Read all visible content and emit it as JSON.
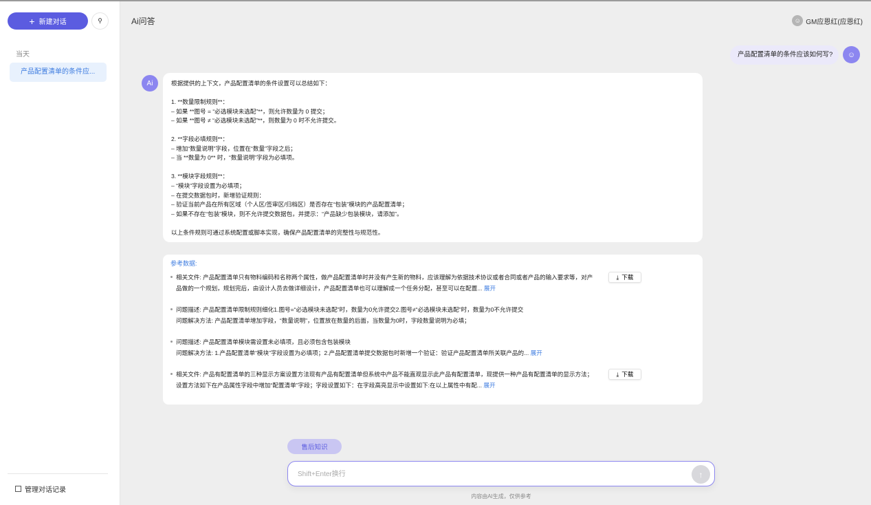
{
  "sidebar": {
    "new_chat": "新建对话",
    "search_icon": "search-icon",
    "section": "当天",
    "conversations": [
      "产品配置清单的条件应..."
    ],
    "manage": "管理对话记录"
  },
  "header": {
    "title": "Ai问答",
    "user": "GM应恩红(应恩红)"
  },
  "chat": {
    "user_message": "产品配置清单的条件应该如何写?",
    "ai_avatar": "Ai",
    "answer": "根据提供的上下文，产品配置清单的条件设置可以总结如下：\n\n1. **数量限制规则**：\n– 如果 **图号 = “必选模块未选配”**，则允许数量为 0 提交；\n– 如果 **图号 ≠ “必选模块未选配”**，则数量为 0 时不允许提交。\n\n2. **字段必填规则**：\n– 增加“数量说明”字段，位置在“数量”字段之后；\n– 当 **数量为 0** 时，“数量说明”字段为必填项。\n\n3. **模块字段规则**：\n– “模块”字段设置为必填项；\n– 在提交数据包时，新增验证规则：\n– 验证当前产品在所有区域（个人区/签审区/归档区）是否存在“包装”模块的产品配置清单；\n– 如果不存在“包装”模块，则不允许提交数据包，并提示：“产品缺少包装模块，请添加”。\n\n以上条件规则可通过系统配置或脚本实现，确保产品配置清单的完整性与规范性。",
    "references_title": "参考数据:",
    "references": [
      {
        "text": "相关文件: 产品配置清单只有物料编码和名称两个属性，做产品配置清单时并没有产生新的物料，应该理解为依据技术协议或者合同或者产品的输入要求等，对产品做的一个规划，规划完后，由设计人员去做详细设计，产品配置清单也可以理解成一个任务分配，甚至可以在配置...",
        "more": "展开",
        "download": "下载"
      },
      {
        "text": "问题描述: 产品配置清单限制规则细化1.图号=“必选模块未选配”时，数量为0允许提交2.图号≠“必选模块未选配”时，数量为0不允许提交\n问题解决方法: 产品配置清单增加字段，“数量说明”，位置放在数量的后面，当数量为0时，字段数量说明为必填；"
      },
      {
        "text": "问题描述: 产品配置清单模块需设置未必填项，且必须包含包装模块\n问题解决方法: 1.产品配置清单“模块”字段设置为必填项；2.产品配置清单提交数据包时新增一个验证：验证产品配置清单所关联产品的...",
        "more": "展开"
      },
      {
        "text": "相关文件: 产品有配置清单的三种显示方案设置方法现有产品有配置清单但系统中产品不能直观显示此产品有配置清单，现提供一种产品有配置清单的显示方法；设置方法如下在产品属性字段中增加“配置清单”字段；字段设置如下：在字段高亮显示中设置如下:在以上属性中有配...",
        "more": "展开",
        "download": "下载"
      }
    ]
  },
  "composer": {
    "tag": "售后知识",
    "placeholder": "Shift+Enter换行",
    "disclaimer": "内容由AI生成，仅供参考"
  }
}
